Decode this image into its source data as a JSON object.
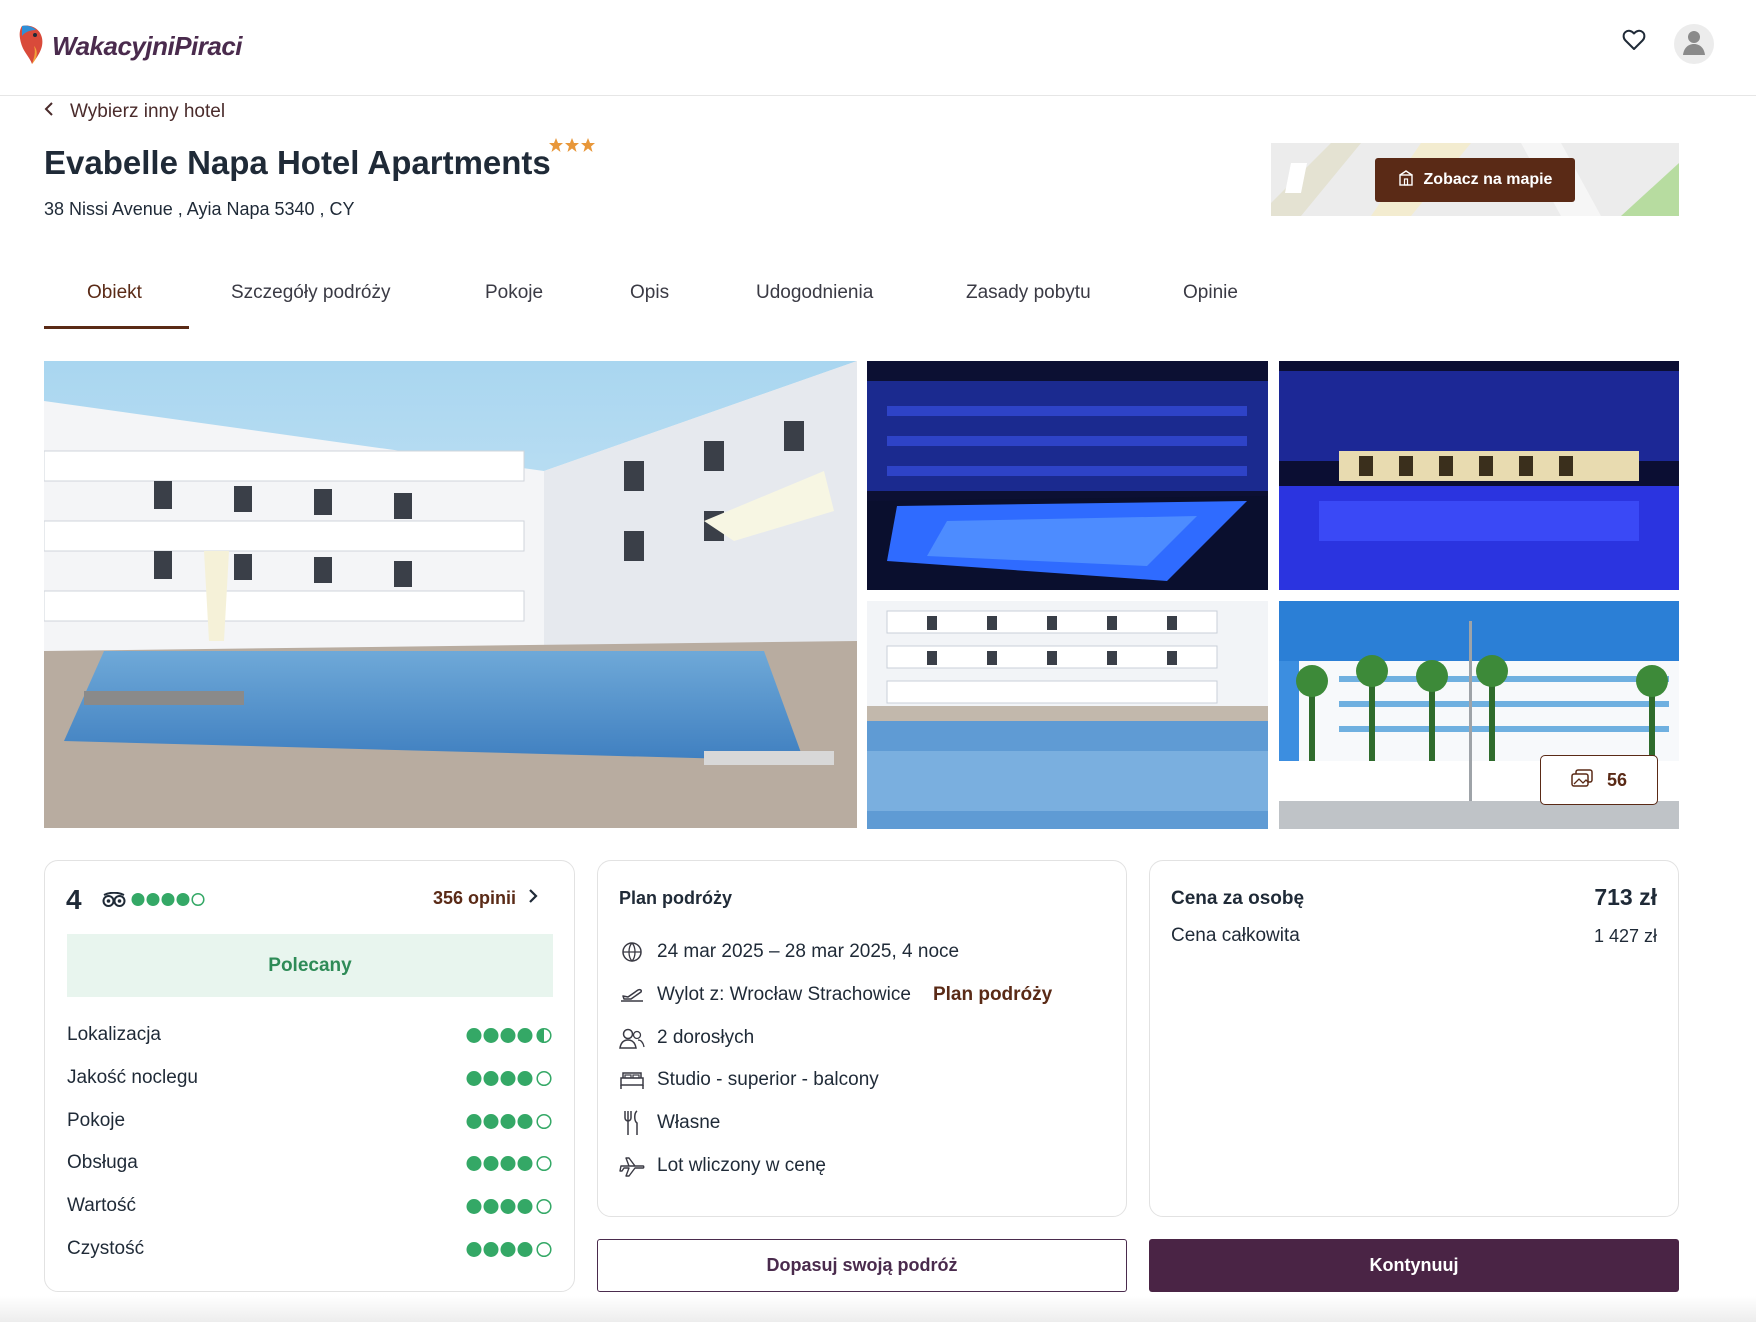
{
  "header": {
    "logo_text": "WakacyjniPiraci",
    "favorites_icon": "heart-icon",
    "account_icon": "user-icon"
  },
  "back_link": {
    "label": "Wybierz inny hotel",
    "icon": "chevron-left-icon"
  },
  "hotel": {
    "name": "Evabelle Napa Hotel Apartments",
    "stars": 3,
    "address": "38 Nissi Avenue , Ayia Napa 5340 , CY"
  },
  "map": {
    "button_label": "Zobacz na mapie",
    "icon": "map-icon"
  },
  "tabs": [
    {
      "label": "Obiekt",
      "active": true
    },
    {
      "label": "Szczegóły podróży",
      "active": false
    },
    {
      "label": "Pokoje",
      "active": false
    },
    {
      "label": "Opis",
      "active": false
    },
    {
      "label": "Udogodnienia",
      "active": false
    },
    {
      "label": "Zasady pobytu",
      "active": false
    },
    {
      "label": "Opinie",
      "active": false
    }
  ],
  "gallery": {
    "photo_count": "56",
    "icon": "photos-icon"
  },
  "reviews": {
    "score": "4",
    "tripadvisor_icon": "tripadvisor-icon",
    "overall_bubbles": 4,
    "count_label": "356 opinii",
    "badge": "Polecany",
    "categories": [
      {
        "label": "Lokalizacja",
        "rating": 4.5
      },
      {
        "label": "Jakość noclegu",
        "rating": 4
      },
      {
        "label": "Pokoje",
        "rating": 4
      },
      {
        "label": "Obsługa",
        "rating": 4
      },
      {
        "label": "Wartość",
        "rating": 4
      },
      {
        "label": "Czystość",
        "rating": 4
      }
    ]
  },
  "plan": {
    "title": "Plan podróży",
    "dates": "24 mar 2025 – 28 mar 2025, 4 noce",
    "departure": "Wylot z: Wrocław Strachowice",
    "departure_link": "Plan podróży",
    "guests": "2 dorosłych",
    "room": "Studio - superior - balcony",
    "board": "Własne",
    "flight": "Lot wliczony w cenę"
  },
  "price": {
    "per_person_label": "Cena za osobę",
    "per_person_value": "713 zł",
    "total_label": "Cena całkowita",
    "total_value": "1 427 zł"
  },
  "actions": {
    "customize_label": "Dopasuj swoją podróż",
    "continue_label": "Kontynuuj"
  },
  "colors": {
    "brand_dark": "#4a2445",
    "accent_brown": "#5a2a16",
    "rating_green": "#34a866",
    "recommended_bg": "#e8f5ee",
    "star_orange": "#e8973a"
  }
}
